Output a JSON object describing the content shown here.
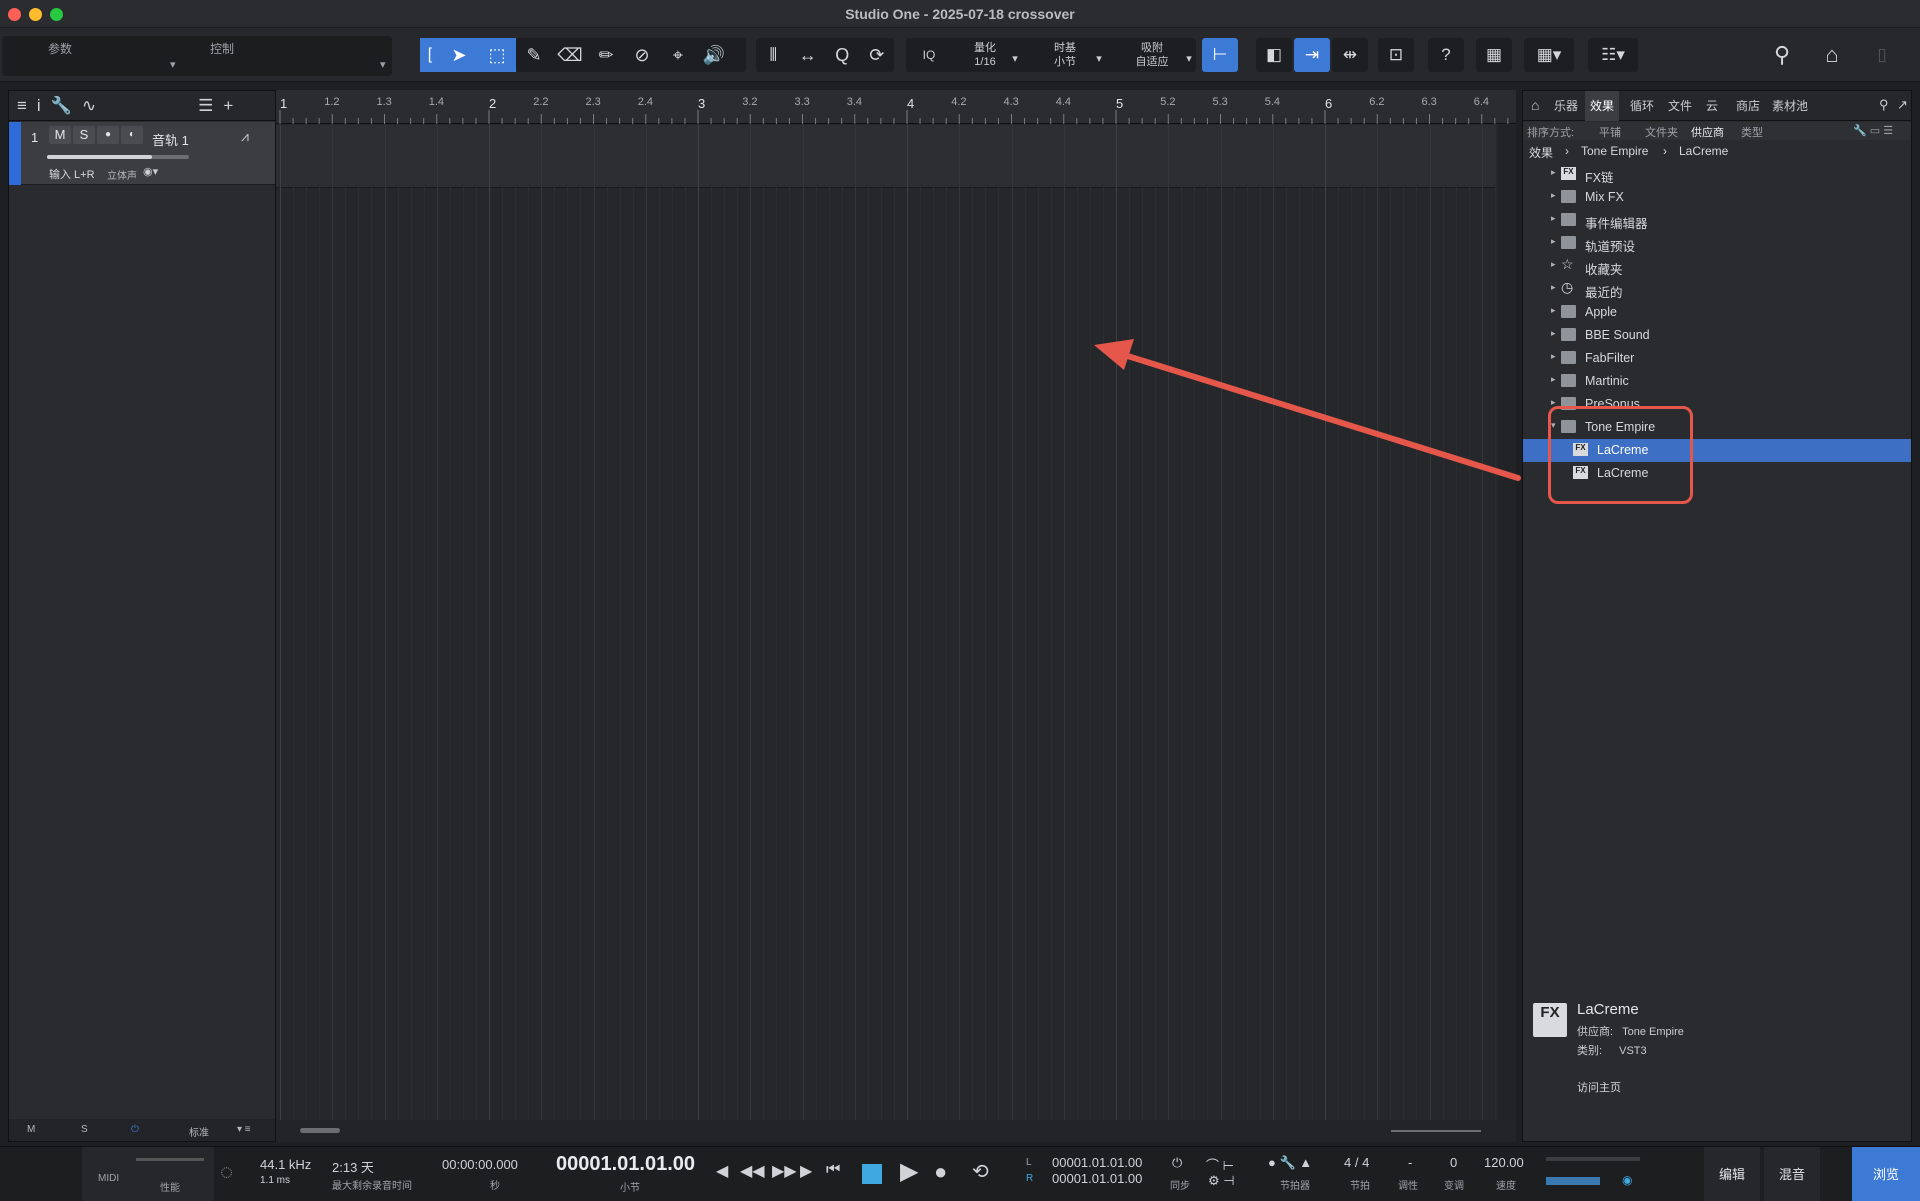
{
  "window": {
    "title": "Studio One - 2025-07-18 crossover"
  },
  "toolbar": {
    "params_label": "参数",
    "control_label": "控制",
    "quantize_label": "量化",
    "quantize_value": "1/16",
    "timebase_label": "时基",
    "timebase_value": "小节",
    "snap_label": "吸附",
    "snap_value": "自适应",
    "iq_label": "IQ",
    "help_label": "?"
  },
  "left_panel": {
    "track": {
      "number": "1",
      "mute": "M",
      "solo": "S",
      "name": "音轨 1",
      "input": "输入 L+R",
      "channel_mode": "立体声"
    },
    "footer": {
      "m": "M",
      "s": "S",
      "mode": "标准"
    }
  },
  "ruler": {
    "ticks": [
      "1",
      "1.2",
      "1.3",
      "1.4",
      "2",
      "2.2",
      "2.3",
      "2.4",
      "3",
      "3.2",
      "3.3",
      "3.4",
      "4",
      "4.2",
      "4.3",
      "4.4",
      "5",
      "5.2",
      "5.3",
      "5.4",
      "6",
      "6.2",
      "6.3",
      "6.4"
    ]
  },
  "browser": {
    "tabs": [
      "乐器",
      "效果",
      "循环",
      "文件",
      "云",
      "商店",
      "素材池"
    ],
    "active_tab": "效果",
    "sort_label": "排序方式:",
    "sort_options": [
      "平铺",
      "文件夹",
      "供应商",
      "类型"
    ],
    "active_sort": "供应商",
    "breadcrumb": [
      "效果",
      "Tone Empire",
      "LaCreme"
    ],
    "tree": [
      {
        "label": "FX链",
        "icon": "fx-chain-icon",
        "expanded": false
      },
      {
        "label": "Mix FX",
        "icon": "mixfx-icon",
        "expanded": false
      },
      {
        "label": "事件编辑器",
        "icon": "event-editor-icon",
        "expanded": false
      },
      {
        "label": "轨道预设",
        "icon": "track-preset-icon",
        "expanded": false
      },
      {
        "label": "收藏夹",
        "icon": "star-icon",
        "expanded": false
      },
      {
        "label": "最近的",
        "icon": "clock-icon",
        "expanded": false
      },
      {
        "label": "Apple",
        "icon": "folder-icon",
        "expanded": false
      },
      {
        "label": "BBE Sound",
        "icon": "folder-icon",
        "expanded": false
      },
      {
        "label": "FabFilter",
        "icon": "folder-icon",
        "expanded": false
      },
      {
        "label": "Martinic",
        "icon": "folder-icon",
        "expanded": false
      },
      {
        "label": "PreSonus",
        "icon": "presonus-icon",
        "expanded": false
      },
      {
        "label": "Tone Empire",
        "icon": "folder-open-icon",
        "expanded": true
      },
      {
        "label": "LaCreme",
        "icon": "fx-plugin-icon",
        "child": true,
        "selected": true
      },
      {
        "label": "LaCreme",
        "icon": "fx-plugin-icon",
        "child": true,
        "selected": false
      }
    ],
    "info": {
      "name": "LaCreme",
      "vendor_label": "供应商:",
      "vendor": "Tone Empire",
      "category_label": "类别:",
      "category": "VST3",
      "homepage_link": "访问主页",
      "badge": "FX"
    }
  },
  "transport": {
    "midi": "MIDI",
    "performance": "性能",
    "sample_rate": "44.1 kHz",
    "latency": "1.1 ms",
    "record_time": "2:13 天",
    "record_time_label": "最大剩余录音时间",
    "time_seconds": "00:00:00.000",
    "time_seconds_unit": "秒",
    "time_bars": "00001.01.01.00",
    "time_bars_unit": "小节",
    "loop_l": "00001.01.01.00",
    "loop_r": "00001.01.01.00",
    "l_label": "L",
    "r_label": "R",
    "sync_label": "同步",
    "metronome_label": "节拍器",
    "time_signature": "4 / 4",
    "time_signature_label": "节拍",
    "key": "-",
    "key_label": "调性",
    "transpose": "0",
    "transpose_label": "变调",
    "tempo": "120.00",
    "tempo_label": "速度",
    "view_edit": "编辑",
    "view_mix": "混音",
    "view_browse": "浏览"
  },
  "colors": {
    "accent": "#3d7ad6",
    "track_color": "#2e6bd6",
    "annotation": "#e4574a"
  }
}
